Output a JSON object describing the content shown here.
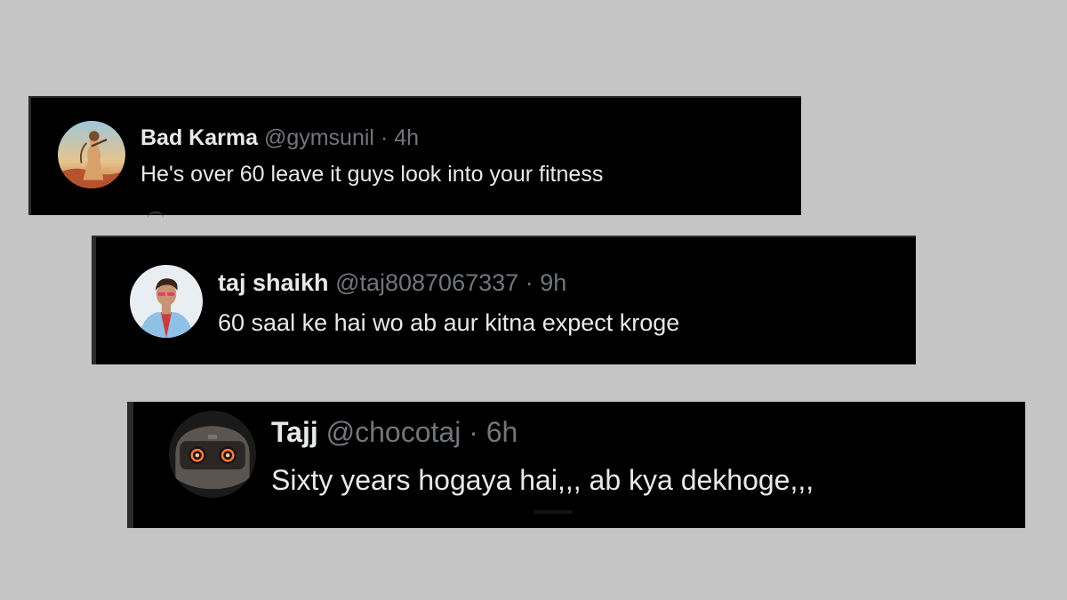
{
  "replies": [
    {
      "name": "Bad Karma",
      "handle": "@gymsunil",
      "separator": "·",
      "time": "4h",
      "text": "He's over 60 leave it guys look into your fitness",
      "avatar_icon": "deity-artwork-avatar"
    },
    {
      "name": "taj shaikh",
      "handle": "@taj8087067337",
      "separator": "·",
      "time": "9h",
      "text": "60 saal ke hai wo ab aur kitna expect kroge",
      "avatar_icon": "person-photo-avatar"
    },
    {
      "name": "Tajj",
      "handle": "@chocotaj",
      "separator": "·",
      "time": "6h",
      "text": "Sixty years hogaya hai,,, ab kya dekhoge,,,",
      "avatar_icon": "robot-avatar"
    }
  ],
  "colors": {
    "background": "#c5c5c5",
    "card": "#000000",
    "primary_text": "#e7e9ea",
    "secondary_text": "#71767b"
  }
}
